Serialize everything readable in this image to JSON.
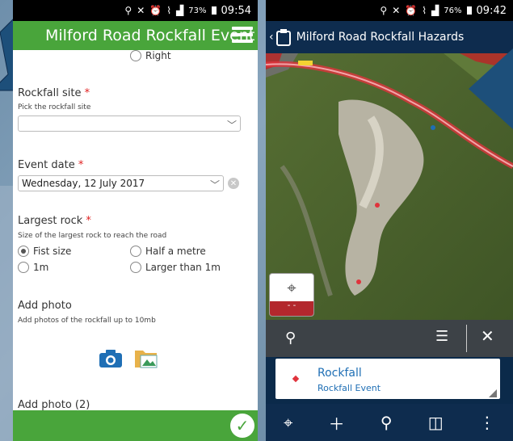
{
  "left": {
    "status": {
      "signal": "73%",
      "time": "09:54"
    },
    "header": {
      "title": "Milford Road Rockfall Event"
    },
    "form": {
      "top_radio": {
        "label": "Right"
      },
      "rockfall_site": {
        "label": "Rockfall site",
        "required_mark": "*",
        "hint": "Pick the rockfall site",
        "value": ""
      },
      "event_date": {
        "label": "Event date",
        "required_mark": "*",
        "value": "Wednesday, 12 July 2017"
      },
      "largest_rock": {
        "label": "Largest rock",
        "required_mark": "*",
        "hint": "Size of the largest rock to reach the road",
        "options": [
          "Fist size",
          "Half a metre",
          "1m",
          "Larger than 1m"
        ],
        "selected": "Fist size"
      },
      "add_photo": {
        "label": "Add photo",
        "hint": "Add photos of the rockfall up to 10mb"
      },
      "add_photo_2": {
        "label": "Add photo (2)"
      }
    }
  },
  "right": {
    "status": {
      "signal": "76%",
      "time": "09:42"
    },
    "header": {
      "title": "Milford Road Rockfall Hazards"
    },
    "locate": {
      "readout": "- -"
    },
    "card": {
      "title": "Rockfall",
      "subtitle": "Rockfall Event"
    }
  },
  "colors": {
    "form_green": "#49a53b",
    "map_navy": "#0e2c4e",
    "required_red": "#e02020",
    "link_blue": "#1f6fb5",
    "road_red": "#e0333c"
  }
}
